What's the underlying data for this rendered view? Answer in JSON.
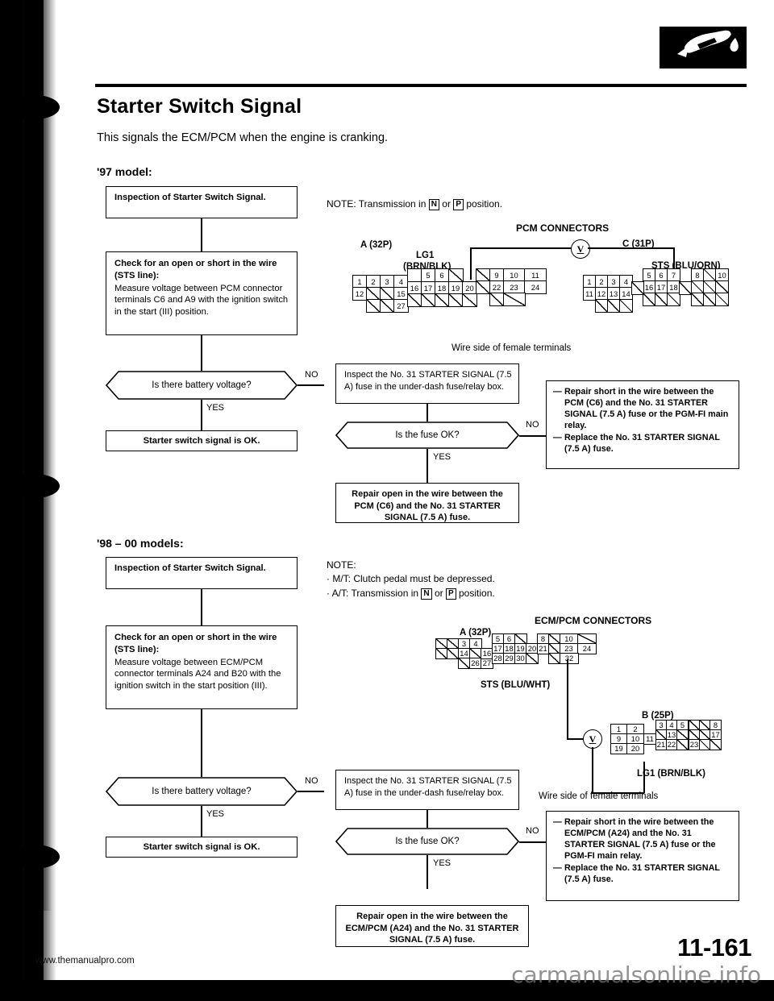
{
  "document": {
    "title": "Starter Switch Signal",
    "intro": "This signals the ECM/PCM when the engine is cranking.",
    "page_number": "11-161",
    "footer_url": "www.themanualpro.com",
    "watermark": "carmanualsonline.info",
    "logo_icon": "fuel-nozzle-icon"
  },
  "section_97": {
    "heading": "'97 model:",
    "note": {
      "prefix": "NOTE:",
      "text_before": "Transmission in",
      "key1": "N",
      "between": "or",
      "key2": "P",
      "text_after": "position."
    },
    "flow": {
      "start_box": "Inspection of Starter Switch Signal.",
      "check_box": {
        "title": "Check for an open or short in the wire (STS line):",
        "body": "Measure voltage between PCM connector terminals C6 and A9 with the ignition switch in the start (III) position."
      },
      "decision_1": "Is there battery voltage?",
      "decision_1_yes": "YES",
      "decision_1_no": "NO",
      "ok_box": "Starter switch signal is OK.",
      "inspect_box": "Inspect the No. 31 STARTER SIGNAL (7.5 A) fuse in the under-dash fuse/relay box.",
      "decision_2": "Is the fuse OK?",
      "decision_2_yes": "YES",
      "decision_2_no": "NO",
      "repair_open_box": "Repair open in the wire between the PCM (C6) and the No. 31 STARTER SIGNAL (7.5 A) fuse.",
      "repair_short_box": [
        "Repair short in the wire between the PCM (C6) and the No. 31 STARTER SIGNAL (7.5 A) fuse or the PGM-FI main relay.",
        "Replace the No. 31 STARTER SIGNAL (7.5 A) fuse."
      ]
    },
    "connectors": {
      "title": "PCM CONNECTORS",
      "wire_side_caption": "Wire side of female terminals",
      "connector_a": {
        "label": "A (32P)",
        "wire_label_line1": "LG1",
        "wire_label_line2": "(BRN/BLK)",
        "groups": [
          {
            "rows": [
              [
                "1",
                "2",
                "3",
                "4"
              ],
              [
                "12",
                "",
                "",
                "15"
              ],
              [
                "",
                "",
                ""
              ]
            ]
          },
          {
            "rows": [
              [
                "16",
                "17",
                "18",
                "19",
                "20"
              ],
              [
                "",
                "27",
                ""
              ]
            ]
          }
        ]
      },
      "connector_c": {
        "label": "C (31P)",
        "wire_label": "STS (BLU/ORN)"
      },
      "meter": "V"
    }
  },
  "section_98": {
    "heading": "'98 – 00 models:",
    "note": {
      "prefix": "NOTE:",
      "line1": "M/T: Clutch pedal must be depressed.",
      "line2_before": "A/T: Transmission in",
      "key1": "N",
      "between": "or",
      "key2": "P",
      "line2_after": "position."
    },
    "flow": {
      "start_box": "Inspection of Starter Switch Signal.",
      "check_box": {
        "title": "Check for an open or short in the wire (STS line):",
        "body": "Measure voltage between ECM/PCM connector terminals A24 and B20 with the ignition switch in the start position (III)."
      },
      "decision_1": "Is there battery voltage?",
      "decision_1_yes": "YES",
      "decision_1_no": "NO",
      "ok_box": "Starter switch signal is OK.",
      "inspect_box": "Inspect the No. 31 STARTER SIGNAL (7.5 A) fuse in the under-dash fuse/relay box.",
      "decision_2": "Is the fuse OK?",
      "decision_2_yes": "YES",
      "decision_2_no": "NO",
      "repair_open_box": "Repair open in the wire between the ECM/PCM (A24) and the No. 31 STARTER SIGNAL (7.5 A) fuse.",
      "repair_short_box": [
        "Repair short in the wire between the ECM/PCM (A24) and the No. 31 STARTER SIGNAL (7.5 A) fuse or the PGM-FI main relay.",
        "Replace the No. 31 STARTER SIGNAL (7.5 A) fuse."
      ]
    },
    "connectors": {
      "title": "ECM/PCM CONNECTORS",
      "wire_side_caption": "Wire side of female terminals",
      "connector_a": {
        "label": "A (32P)",
        "wire_label": "STS (BLU/WHT)"
      },
      "connector_b": {
        "label": "B (25P)",
        "wire_label": "LG1 (BRN/BLK)"
      },
      "meter": "V"
    }
  },
  "pin_grids": {
    "a32p_97": {
      "g1": [
        [
          "1",
          "2",
          "3",
          "4"
        ],
        [
          "12",
          "/",
          "/",
          "15"
        ],
        [
          "",
          "/",
          "/",
          ""
        ]
      ],
      "g2": [
        [
          "5",
          "6",
          "/"
        ],
        [
          "16",
          "17",
          "18",
          "19",
          "20"
        ],
        [
          "/",
          "27",
          "/",
          "/",
          "/"
        ]
      ],
      "g3": [
        [
          "/",
          "9",
          "10",
          "11"
        ],
        [
          "22",
          "23",
          "24"
        ],
        [
          "/",
          "/"
        ]
      ]
    },
    "c31p_97": {
      "g1": [
        [
          "1",
          "2",
          "3",
          "4"
        ],
        [
          "11",
          "12",
          "13",
          "14"
        ],
        [
          "/",
          "/",
          "/"
        ]
      ],
      "g2": [
        [
          "5",
          "6",
          "7"
        ],
        [
          "16",
          "17",
          "18"
        ],
        [
          "/",
          "/",
          "/"
        ]
      ],
      "g3": [
        [
          "8",
          "/",
          "10"
        ],
        [
          "/",
          "/",
          "/"
        ],
        [
          "/",
          "/",
          "/"
        ]
      ]
    },
    "a32p_98": {
      "g1": [
        [
          "/",
          "/",
          "3",
          "4"
        ],
        [
          "/",
          "/",
          "14",
          "/",
          "16"
        ],
        [
          "/",
          "26",
          "27"
        ]
      ],
      "g2": [
        [
          "5",
          "6",
          "/"
        ],
        [
          "17",
          "18",
          "19",
          "20"
        ],
        [
          "28",
          "29",
          "30"
        ]
      ],
      "g3": [
        [
          "8",
          "/",
          "10"
        ],
        [
          "21",
          "/",
          "23",
          "24"
        ],
        [
          "/",
          "32"
        ]
      ]
    },
    "b25p_98": {
      "g1": [
        [
          "1",
          "2"
        ],
        [
          "9",
          "10"
        ],
        [
          "19",
          "20"
        ]
      ],
      "g2": [
        [
          "3",
          "4",
          "5"
        ],
        [
          "11",
          "/",
          "13"
        ],
        [
          "21",
          "22"
        ]
      ],
      "g3": [
        [
          "/",
          "/",
          "8"
        ],
        [
          "/",
          "/",
          "17"
        ],
        [
          "23",
          "/",
          "/"
        ]
      ]
    }
  }
}
